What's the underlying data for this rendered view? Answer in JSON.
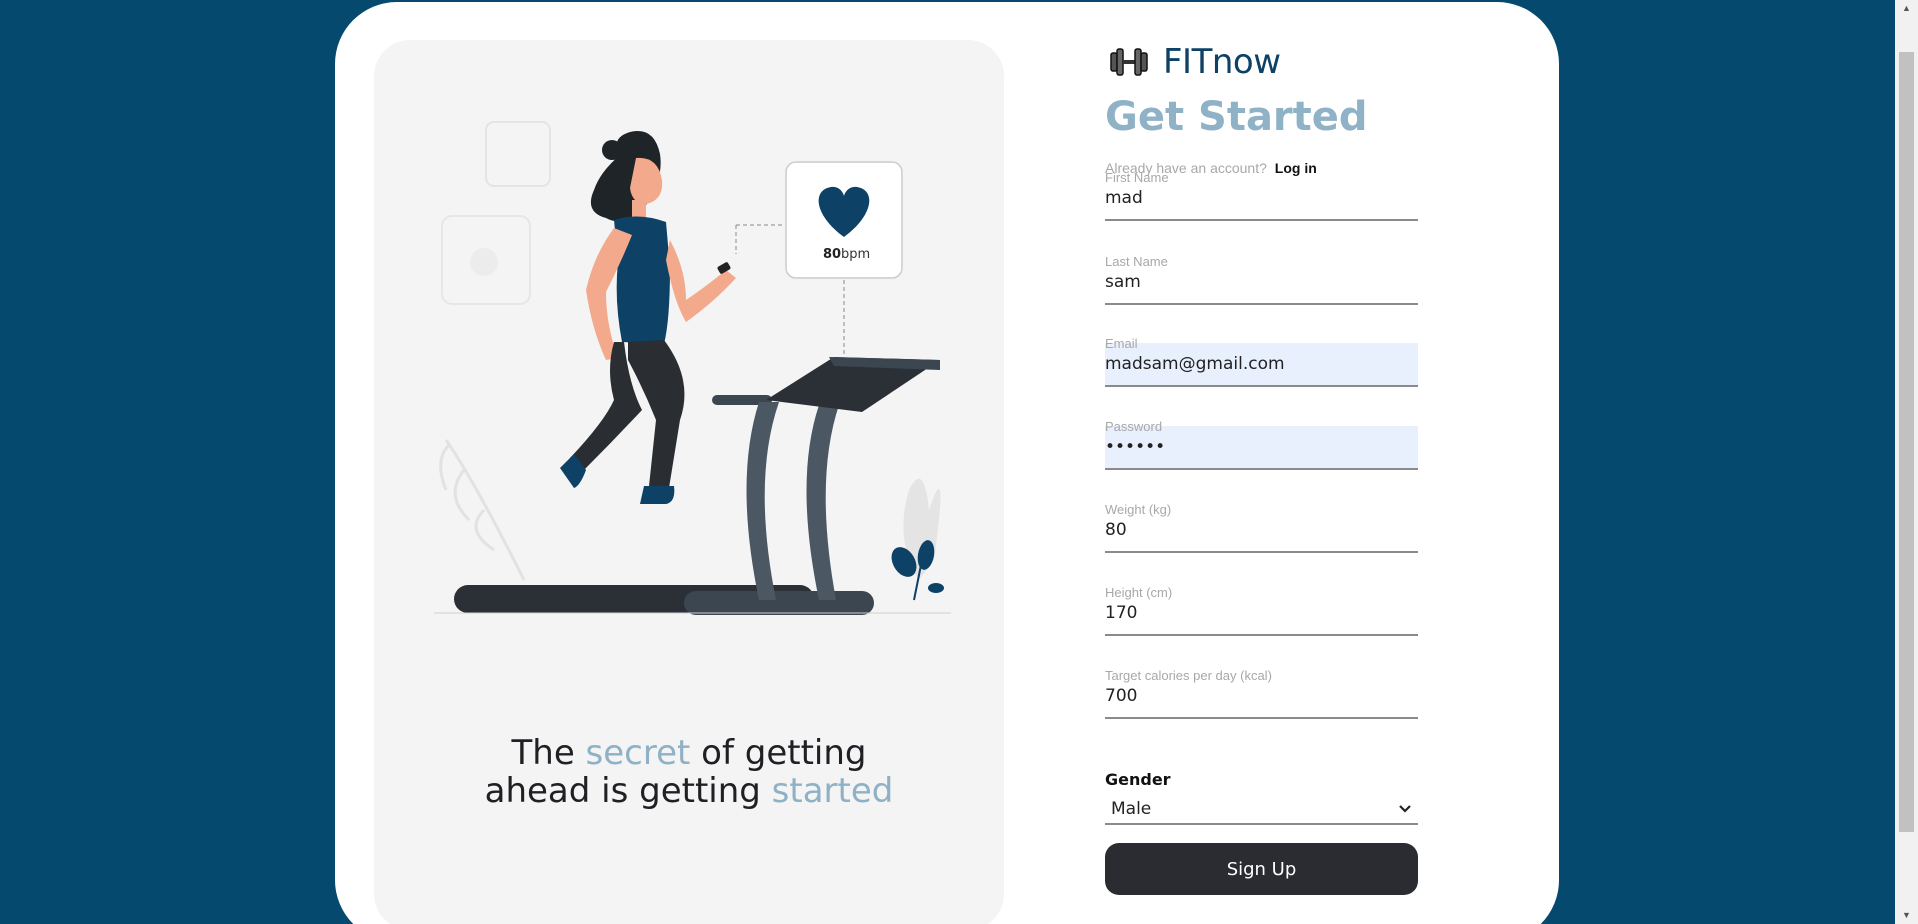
{
  "brand": {
    "name": "FITnow",
    "icon": "dumbbell-icon"
  },
  "title": "Get Started",
  "login": {
    "prompt": "Already have an account?",
    "link": "Log in"
  },
  "fields": {
    "first_name": {
      "label": "First Name",
      "value": "mad"
    },
    "last_name": {
      "label": "Last Name",
      "value": "sam"
    },
    "email": {
      "label": "Email",
      "value": "madsam@gmail.com"
    },
    "password": {
      "label": "Password",
      "value": "••••••"
    },
    "weight": {
      "label": "Weight (kg)",
      "value": "80"
    },
    "height": {
      "label": "Height (cm)",
      "value": "170"
    },
    "calories": {
      "label": "Target calories per day (kcal)",
      "value": "700"
    }
  },
  "gender": {
    "label": "Gender",
    "selected": "Male"
  },
  "signup": {
    "label": "Sign Up"
  },
  "illustration": {
    "bpm_value": "80",
    "bpm_unit": "bpm"
  },
  "tagline": {
    "part1": "The ",
    "accent1": "secret",
    "part2": " of getting",
    "part3": "ahead is getting ",
    "accent2": "started"
  },
  "colors": {
    "background": "#054a6e",
    "brand": "#0d4166",
    "accent": "#8fb2c6",
    "button": "#2a2c31",
    "autofill": "#e8f0fe"
  }
}
